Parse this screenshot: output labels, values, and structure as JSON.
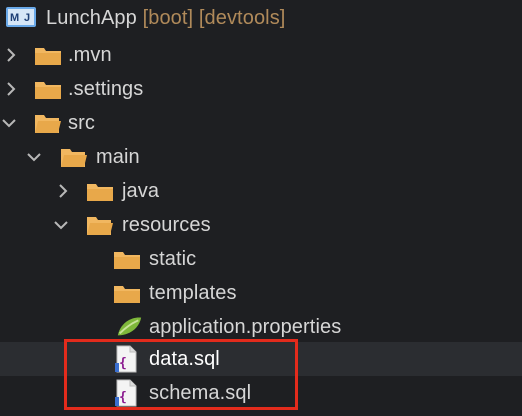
{
  "project": {
    "name": "LunchApp",
    "decorations": "[boot] [devtools]",
    "badge_text": "M J",
    "badge_icon": "maven-project-icon"
  },
  "tree": {
    "mvn": "\u0002.mvn",
    "settings": ".settings",
    "src": "src",
    "main": "main",
    "java": "java",
    "resources": "resources",
    "static": "static",
    "templates": "templates",
    "application_properties": "application.properties",
    "data_sql": "data.sql",
    "schema_sql": "schema.sql"
  },
  "colors": {
    "background": "#1e1f22",
    "selection": "#2b2d31",
    "folder": "#e8a84a",
    "highlight": "#e32b1c",
    "decorations": "#b08a5a"
  }
}
